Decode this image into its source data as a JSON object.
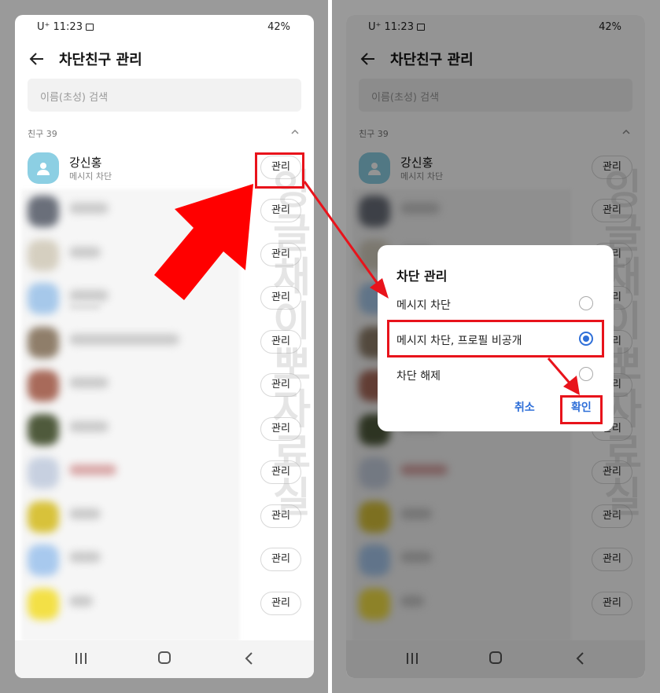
{
  "status": {
    "carrier_time": "U⁺ 11:23",
    "signal_battery": "42%"
  },
  "header": {
    "title": "차단친구 관리"
  },
  "search": {
    "placeholder": "이름(초성) 검색"
  },
  "section": {
    "label": "친구 39"
  },
  "first_friend": {
    "name": "강신홍",
    "status": "메시지 차단"
  },
  "manage_label": "관리",
  "watermark": "잉글채이뽀자료실",
  "dialog": {
    "title": "차단 관리",
    "options": [
      "메시지 차단",
      "메시지 차단, 프로필 비공개",
      "차단 해제"
    ],
    "selected_index": 1,
    "cancel": "취소",
    "confirm": "확인"
  },
  "colors": {
    "highlight": "#e8131b",
    "accent": "#2f6fd8",
    "avatar": "#8ccfe3"
  },
  "icons": [
    "back-arrow-icon",
    "chevron-up-icon",
    "person-icon",
    "recent-apps-icon",
    "home-icon",
    "back-icon"
  ]
}
